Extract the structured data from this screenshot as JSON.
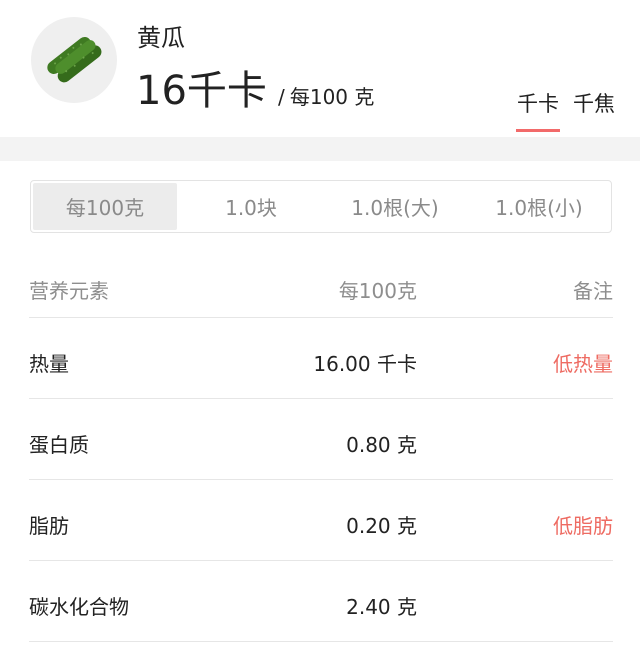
{
  "food": {
    "name": "黄瓜",
    "calories": "16千卡",
    "per_separator": "/",
    "per_label": "每100 克",
    "image_icon": "cucumber-icon"
  },
  "unit_tabs": [
    {
      "label": "千卡",
      "active": true
    },
    {
      "label": "千焦",
      "active": false
    }
  ],
  "portions": [
    {
      "label": "每100克",
      "active": true
    },
    {
      "label": "1.0块",
      "active": false
    },
    {
      "label": "1.0根(大)",
      "active": false
    },
    {
      "label": "1.0根(小)",
      "active": false
    }
  ],
  "table": {
    "headers": {
      "name": "营养元素",
      "value": "每100克",
      "note": "备注"
    },
    "rows": [
      {
        "name": "热量",
        "value": "16.00 千卡",
        "note": "低热量"
      },
      {
        "name": "蛋白质",
        "value": "0.80 克",
        "note": ""
      },
      {
        "name": "脂肪",
        "value": "0.20 克",
        "note": "低脂肪"
      },
      {
        "name": "碳水化合物",
        "value": "2.40 克",
        "note": ""
      }
    ]
  },
  "colors": {
    "accent": "#ee6b62",
    "divider": "#e6e6e6",
    "band": "#f3f3f3"
  }
}
